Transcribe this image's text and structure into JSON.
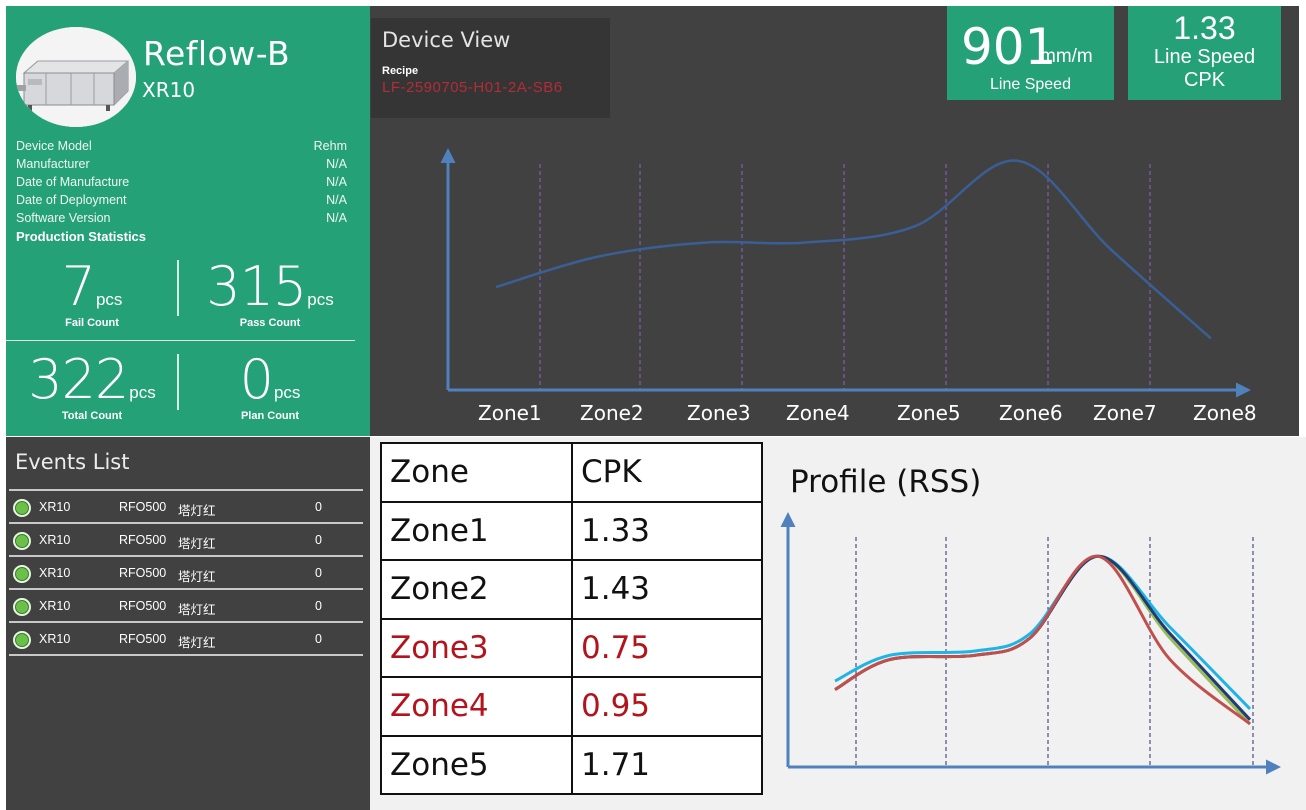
{
  "device": {
    "name": "Reflow-B",
    "model_code": "XR10",
    "specs": [
      {
        "label": "Device Model",
        "value": "Rehm"
      },
      {
        "label": "Manufacturer",
        "value": "N/A"
      },
      {
        "label": "Date of Manufacture",
        "value": "N/A"
      },
      {
        "label": "Date of Deployment",
        "value": "N/A"
      },
      {
        "label": "Software Version",
        "value": "N/A"
      }
    ],
    "production_title": "Production Statistics",
    "stats": [
      {
        "value": "7",
        "unit": "pcs",
        "label": "Fail Count"
      },
      {
        "value": "315",
        "unit": "pcs",
        "label": "Pass Count"
      },
      {
        "value": "322",
        "unit": "pcs",
        "label": "Total Count"
      },
      {
        "value": "0",
        "unit": "pcs",
        "label": "Plan Count"
      }
    ]
  },
  "view": {
    "title": "Device View",
    "recipe_label": "Recipe",
    "recipe_value": "LF-2590705-H01-2A-SB6",
    "line_speed": {
      "value": "901",
      "unit": "mm/m",
      "label": "Line Speed"
    },
    "cpk_kpi": {
      "value": "1.33",
      "label_line1": "Line Speed",
      "label_line2": "CPK"
    }
  },
  "chart_data": [
    {
      "type": "line",
      "categories": [
        "Zone1",
        "Zone2",
        "Zone3",
        "Zone4",
        "Zone5",
        "Zone6",
        "Zone7",
        "Zone8"
      ],
      "series": [
        {
          "values": [
            0.44,
            0.57,
            0.63,
            0.63,
            0.7,
            0.98,
            0.6,
            0.22
          ]
        }
      ],
      "grid": "vertical dashed",
      "colors": {
        "line": "#3a5f97",
        "grid": "#7e5fae",
        "axis": "#4f81bd"
      }
    },
    {
      "type": "line",
      "title": "Profile (RSS)",
      "series": [
        {
          "color": "#1fb4e6",
          "values": [
            0.4,
            0.52,
            0.54,
            0.62,
            0.98,
            0.65,
            0.27
          ]
        },
        {
          "color": "#9bbb59",
          "values": [
            0.36,
            0.5,
            0.52,
            0.6,
            0.98,
            0.6,
            0.2
          ]
        },
        {
          "color": "#1f3d73",
          "values": [
            0.36,
            0.5,
            0.52,
            0.6,
            0.98,
            0.62,
            0.22
          ]
        },
        {
          "color": "#c0504d",
          "values": [
            0.36,
            0.5,
            0.52,
            0.6,
            0.98,
            0.5,
            0.2
          ]
        }
      ],
      "grid": "vertical dashed",
      "colors": {
        "axis": "#4f81bd",
        "grid": "#2a2a6a"
      }
    }
  ],
  "events": {
    "title": "Events List",
    "items": [
      {
        "status": "green",
        "device": "XR10",
        "code": "RFO500",
        "desc": "塔灯红",
        "count": "0"
      },
      {
        "status": "green",
        "device": "XR10",
        "code": "RFO500",
        "desc": "塔灯红",
        "count": "0"
      },
      {
        "status": "green",
        "device": "XR10",
        "code": "RFO500",
        "desc": "塔灯红",
        "count": "0"
      },
      {
        "status": "green",
        "device": "XR10",
        "code": "RFO500",
        "desc": "塔灯红",
        "count": "0"
      },
      {
        "status": "green",
        "device": "XR10",
        "code": "RFO500",
        "desc": "塔灯红",
        "count": "0"
      }
    ]
  },
  "cpk_table": {
    "headers": [
      "Zone",
      "CPK"
    ],
    "rows": [
      {
        "zone": "Zone1",
        "cpk": "1.33",
        "alert": false
      },
      {
        "zone": "Zone2",
        "cpk": "1.43",
        "alert": false
      },
      {
        "zone": "Zone3",
        "cpk": "0.75",
        "alert": true
      },
      {
        "zone": "Zone4",
        "cpk": "0.95",
        "alert": true
      },
      {
        "zone": "Zone5",
        "cpk": "1.71",
        "alert": false
      }
    ],
    "alert_color": "#b3131c"
  },
  "theme": {
    "accent": "#25a178",
    "panel_dark": "#414141",
    "recipe_color": "#b42c37"
  }
}
